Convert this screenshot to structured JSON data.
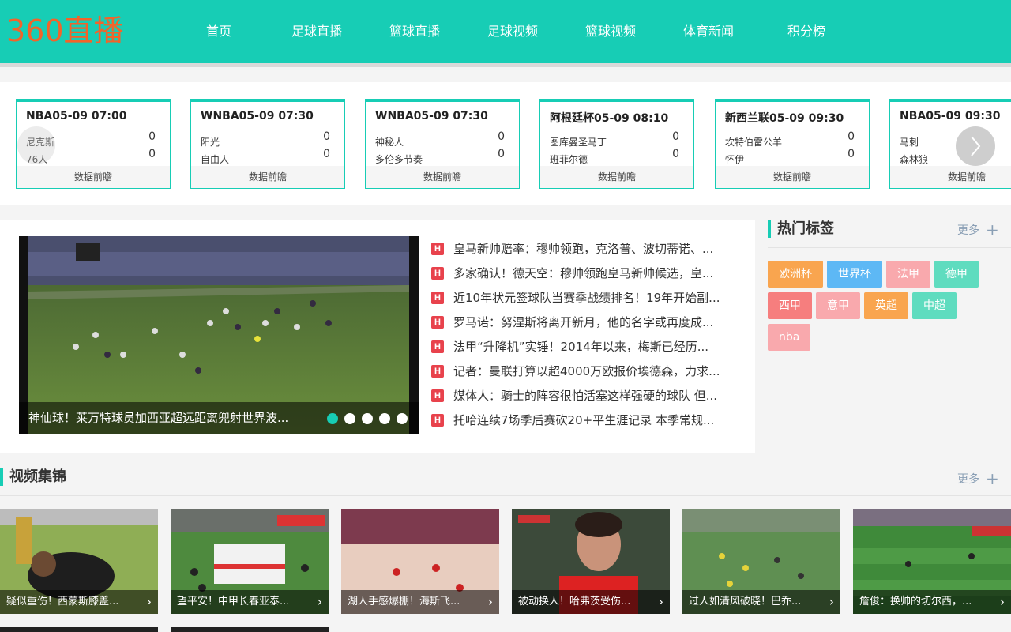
{
  "header": {
    "logo": "360直播",
    "nav": [
      "首页",
      "足球直播",
      "篮球直播",
      "足球视频",
      "篮球视频",
      "体育新闻",
      "积分榜"
    ]
  },
  "matches": [
    {
      "title": "NBA05-09 07:00",
      "home": "尼克斯",
      "away": "76人",
      "home_score": "0",
      "away_score": "0",
      "footer": "数据前瞻"
    },
    {
      "title": "WNBA05-09 07:30",
      "home": "阳光",
      "away": "自由人",
      "home_score": "0",
      "away_score": "0",
      "footer": "数据前瞻"
    },
    {
      "title": "WNBA05-09 07:30",
      "home": "神秘人",
      "away": "多伦多节奏",
      "home_score": "0",
      "away_score": "0",
      "footer": "数据前瞻"
    },
    {
      "title": "阿根廷杯05-09 08:10",
      "home": "图库曼圣马丁",
      "away": "班菲尔德",
      "home_score": "0",
      "away_score": "0",
      "footer": "数据前瞻"
    },
    {
      "title": "新西兰联05-09 09:30",
      "home": "坎特伯雷公羊",
      "away": "怀伊",
      "home_score": "0",
      "away_score": "0",
      "footer": "数据前瞻"
    },
    {
      "title": "NBA05-09 09:30",
      "home": "马刺",
      "away": "森林狼",
      "home_score": "",
      "away_score": "",
      "footer": "数据前瞻"
    }
  ],
  "slider": {
    "caption": "神仙球！莱万特球员加西亚超远距离兜射世界波...",
    "dot_count": 5,
    "active_dot": 0
  },
  "news": [
    "皇马新帅赔率：穆帅领跑，克洛普、波切蒂诺、...",
    "多家确认！德天空：穆帅领跑皇马新帅候选，皇...",
    "近10年状元签球队当赛季战绩排名！19年开始副...",
    "罗马诺：努涅斯将离开新月，他的名字或再度成...",
    "法甲“升降机”实锤！2014年以来，梅斯已经历...",
    "记者：曼联打算以超4000万欧报价埃德森，力求...",
    "媒体人：骑士的阵容很怕活塞这样强硬的球队 但...",
    "托哈连续7场季后赛砍20+平生涯记录 本季常规..."
  ],
  "hot_tags": {
    "title": "热门标签",
    "more": "更多",
    "tags": [
      {
        "label": "欧洲杯",
        "color": "#f9a54f"
      },
      {
        "label": "世界杯",
        "color": "#5db8f5"
      },
      {
        "label": "法甲",
        "color": "#f9a9ad"
      },
      {
        "label": "德甲",
        "color": "#5fdcbf"
      },
      {
        "label": "西甲",
        "color": "#f67e7e"
      },
      {
        "label": "意甲",
        "color": "#f9a9ad"
      },
      {
        "label": "英超",
        "color": "#f9a54f"
      },
      {
        "label": "中超",
        "color": "#5fdcbf"
      },
      {
        "label": "nba",
        "color": "#f9a9ad"
      }
    ]
  },
  "videos": {
    "title": "视频集锦",
    "more": "更多",
    "items": [
      {
        "title": "疑似重伤！西蒙斯膝盖..."
      },
      {
        "title": "望平安！中甲长春亚泰..."
      },
      {
        "title": "湖人手感爆棚！海斯飞..."
      },
      {
        "title": "被动换人！哈弗茨受伤..."
      },
      {
        "title": "过人如清风破晓！巴乔..."
      },
      {
        "title": "詹俊：换帅的切尔西，..."
      }
    ]
  },
  "colors": {
    "accent": "#17cdb5",
    "logo": "#f2642a",
    "hot_badge": "#e8424c"
  }
}
